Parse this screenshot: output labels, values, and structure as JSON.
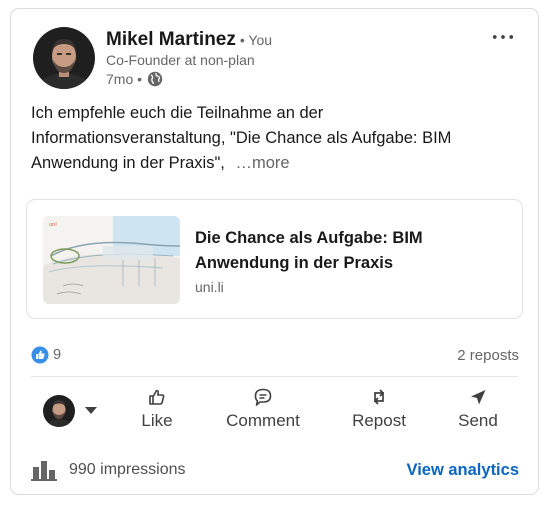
{
  "post": {
    "author": {
      "name": "Mikel Martinez",
      "relation": "• You",
      "headline": "Co-Founder at non-plan",
      "time": "7mo •",
      "visibility_icon": "globe-icon"
    },
    "body_text": "Ich empfehle euch die Teilnahme an der Informationsveranstaltung, \"Die Chance als Aufgabe: BIM Anwendung in der Praxis\",",
    "see_more": "…more",
    "link_preview": {
      "title": "Die Chance als Aufgabe: BIM Anwendung in der Praxis",
      "domain": "uni.li"
    },
    "reactions_count": "9",
    "reposts": "2 reposts"
  },
  "actions": {
    "like": "Like",
    "comment": "Comment",
    "repost": "Repost",
    "send": "Send"
  },
  "footer": {
    "impressions": "990 impressions",
    "view_analytics": "View analytics"
  },
  "colors": {
    "accent": "#0a66c2",
    "secondary_text": "#666666"
  }
}
